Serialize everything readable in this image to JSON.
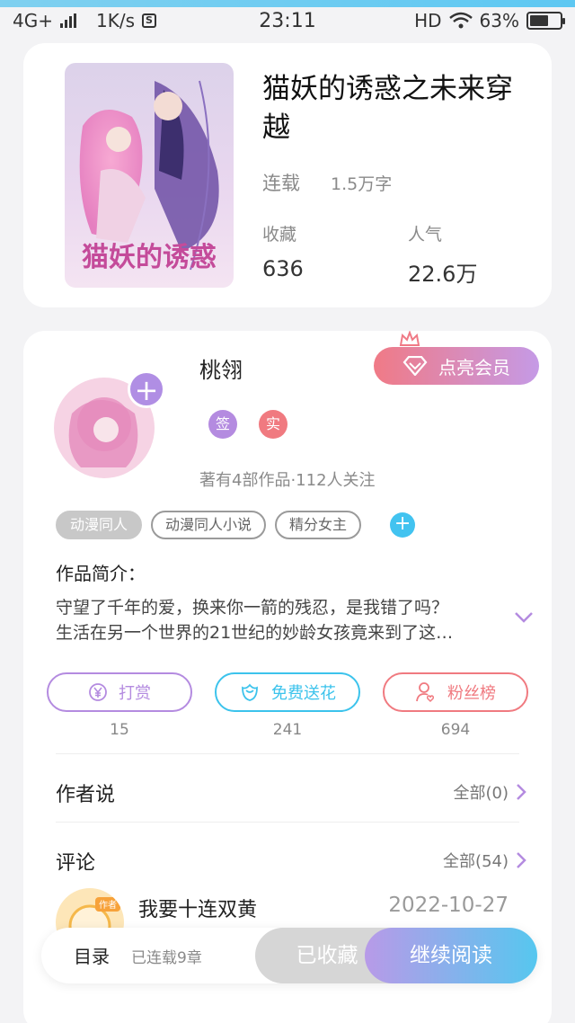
{
  "status_bar": {
    "network": "4G+",
    "speed": "1K/s",
    "time": "23:11",
    "hd": "HD",
    "battery": "63%",
    "battery_level": 0.63
  },
  "book": {
    "title": "猫妖的诱惑之未来穿越",
    "status": "连载",
    "word_count": "1.5万字",
    "favorites_label": "收藏",
    "favorites_value": "636",
    "popularity_label": "人气",
    "popularity_value": "22.6万",
    "cover_art_text": "猫妖的诱惑"
  },
  "author": {
    "name": "桃翎",
    "badge_sign": "签",
    "badge_real": "实",
    "stats": "著有4部作品·112人关注",
    "vip_label": "点亮会员"
  },
  "tags": [
    "动漫同人",
    "动漫同人小说",
    "精分女主"
  ],
  "intro": {
    "label": "作品简介：",
    "line1": "守望了千年的爱，换来你一箭的残忍，是我错了吗？",
    "line2": "生活在另一个世界的21世纪的妙龄女孩竟来到了这…"
  },
  "actions": [
    {
      "label": "打赏",
      "count": "15",
      "color": "#b48be0"
    },
    {
      "label": "免费送花",
      "count": "241",
      "color": "#3cc3ec"
    },
    {
      "label": "粉丝榜",
      "count": "694",
      "color": "#f07a80"
    }
  ],
  "author_says": {
    "title": "作者说",
    "all": "全部(0)"
  },
  "comments": {
    "title": "评论",
    "all": "全部(54)",
    "first_user": "我要十连双黄",
    "first_date": "2022-10-27",
    "first_badge": "作者"
  },
  "bottom_bar": {
    "catalog": "目录",
    "chapters": "已连载9章",
    "collected": "已收藏",
    "continue": "继续阅读"
  }
}
